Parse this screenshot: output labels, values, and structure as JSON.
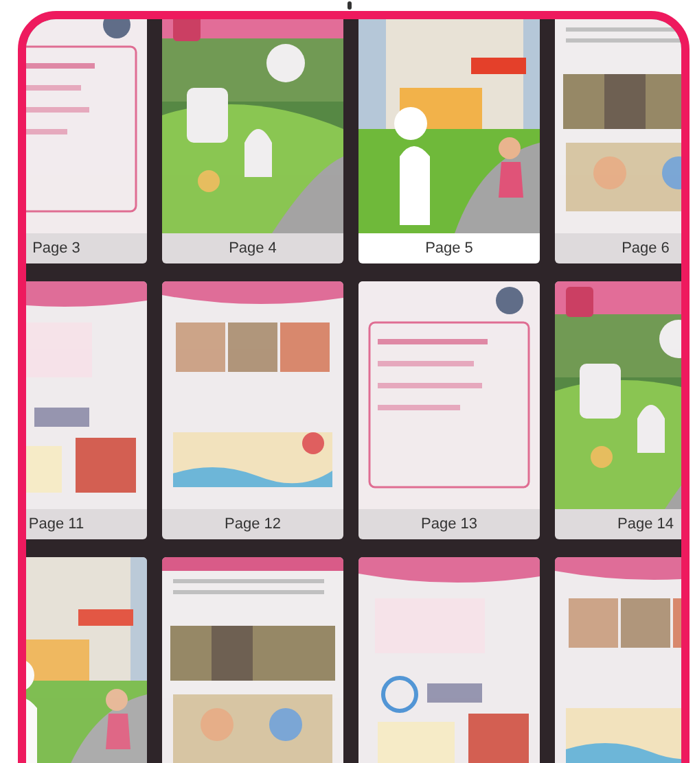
{
  "pages": [
    {
      "kind": "picture",
      "label": "Page 3",
      "selected": false
    },
    {
      "kind": "picture",
      "label": "Page 4",
      "selected": false
    },
    {
      "kind": "picture",
      "label": "Page 5",
      "selected": true
    },
    {
      "kind": "picture",
      "label": "Page 6",
      "selected": false
    },
    {
      "kind": "picture",
      "label": "Page 11",
      "selected": false
    },
    {
      "kind": "picture",
      "label": "Page 12",
      "selected": false
    },
    {
      "kind": "picture",
      "label": "Page 13",
      "selected": false
    },
    {
      "kind": "picture",
      "label": "Page 14",
      "selected": false
    },
    {
      "kind": "picture",
      "selected": false
    },
    {
      "kind": "picture",
      "selected": false
    },
    {
      "kind": "picture",
      "selected": false
    },
    {
      "kind": "picture",
      "selected": false
    }
  ]
}
